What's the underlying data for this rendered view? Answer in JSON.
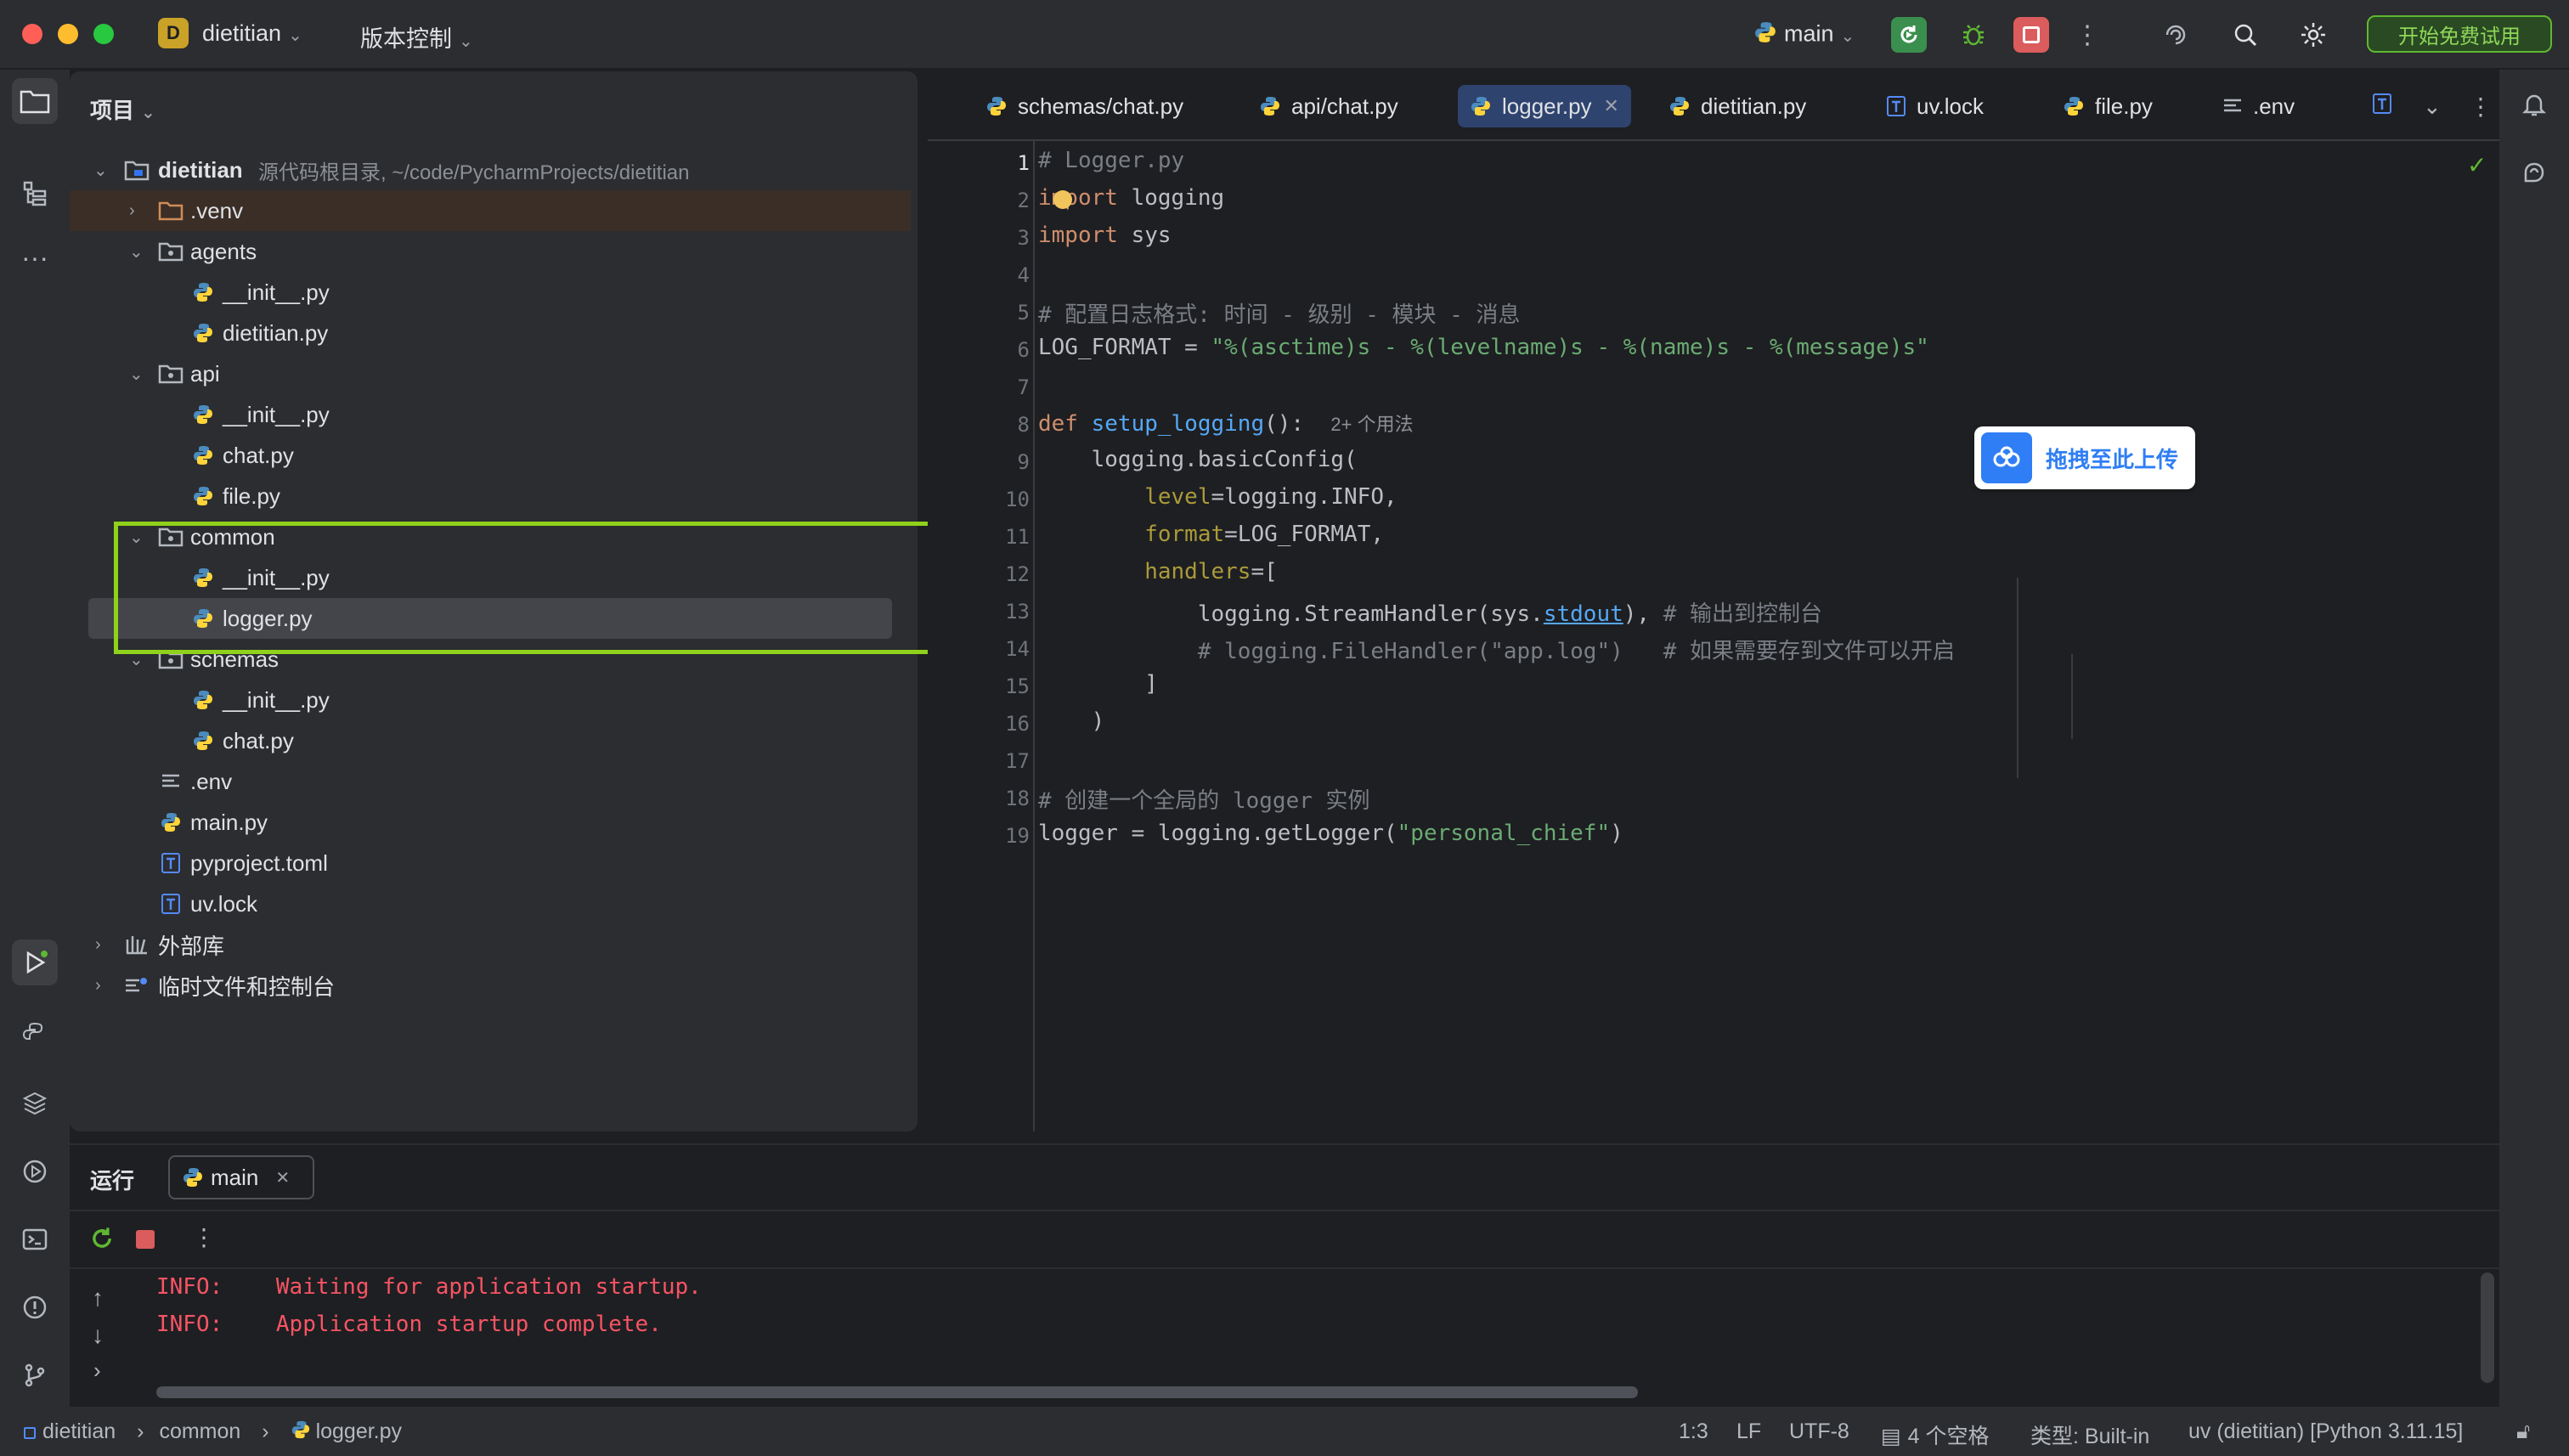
{
  "titlebar": {
    "project_badge": "D",
    "project_name": "dietitian",
    "vcs_menu": "版本控制",
    "branch": "main",
    "trial_button": "开始免费试用"
  },
  "project_panel": {
    "header": "项目",
    "root_name": "dietitian",
    "root_hint": "源代码根目录, ~/code/PycharmProjects/dietitian",
    "items": [
      {
        "label": ".venv"
      },
      {
        "label": "agents"
      },
      {
        "label": "__init__.py"
      },
      {
        "label": "dietitian.py"
      },
      {
        "label": "api"
      },
      {
        "label": "__init__.py"
      },
      {
        "label": "chat.py"
      },
      {
        "label": "file.py"
      },
      {
        "label": "common"
      },
      {
        "label": "__init__.py"
      },
      {
        "label": "logger.py"
      },
      {
        "label": "schemas"
      },
      {
        "label": "__init__.py"
      },
      {
        "label": "chat.py"
      },
      {
        "label": ".env"
      },
      {
        "label": "main.py"
      },
      {
        "label": "pyproject.toml"
      },
      {
        "label": "uv.lock"
      },
      {
        "label": "外部库"
      },
      {
        "label": "临时文件和控制台"
      }
    ]
  },
  "editor": {
    "tabs": [
      {
        "label": "schemas/chat.py"
      },
      {
        "label": "api/chat.py"
      },
      {
        "label": "logger.py"
      },
      {
        "label": "dietitian.py"
      },
      {
        "label": "uv.lock"
      },
      {
        "label": "file.py"
      },
      {
        "label": ".env"
      }
    ],
    "usage_hint": "2+ 个用法",
    "code": {
      "l1": "# Logger.py",
      "l2_kw": "import",
      "l2_rest": " logging",
      "l3_kw": "import",
      "l3_rest": " sys",
      "l5": "# 配置日志格式: 时间 - 级别 - 模块 - 消息",
      "l6_a": "LOG_FORMAT = ",
      "l6_str": "\"%(asctime)s - %(levelname)s - %(name)s - %(message)s\"",
      "l8_kw": "def",
      "l8_fn": " setup_logging",
      "l8_rest": "():",
      "l9": "    logging.basicConfig(",
      "l10_p": "        level",
      "l10_rest": "=logging.INFO,",
      "l11_p": "        format",
      "l11_rest": "=LOG_FORMAT,",
      "l12_p": "        handlers",
      "l12_rest": "=[",
      "l13_a": "            logging.StreamHandler(sys.",
      "l13_link": "stdout",
      "l13_b": "),",
      "l13_cm": " # 输出到控制台",
      "l14": "            # logging.FileHandler(\"app.log\")   # 如果需要存到文件可以开启",
      "l15": "        ]",
      "l16": "    )",
      "l18": "# 创建一个全局的 logger 实例",
      "l19_a": "logger = logging.getLogger(",
      "l19_str": "\"personal_chief\"",
      "l19_b": ")"
    }
  },
  "upload_popup": "拖拽至此上传",
  "run_panel": {
    "title": "运行",
    "tab": "main",
    "log": [
      {
        "level": "INFO:",
        "msg": "Waiting for application startup."
      },
      {
        "level": "INFO:",
        "msg": "Application startup complete."
      }
    ]
  },
  "statusbar": {
    "crumb1": "dietitian",
    "crumb2": "common",
    "crumb3": "logger.py",
    "position": "1:3",
    "line_sep": "LF",
    "encoding": "UTF-8",
    "indent": "4 个空格",
    "type": "类型: Built-in",
    "interpreter": "uv (dietitian) [Python 3.11.15]"
  },
  "colors": {
    "accent": "#3574f0",
    "highlight_box": "#8fd11b",
    "trial": "#5fb832",
    "error_red": "#f75464"
  }
}
